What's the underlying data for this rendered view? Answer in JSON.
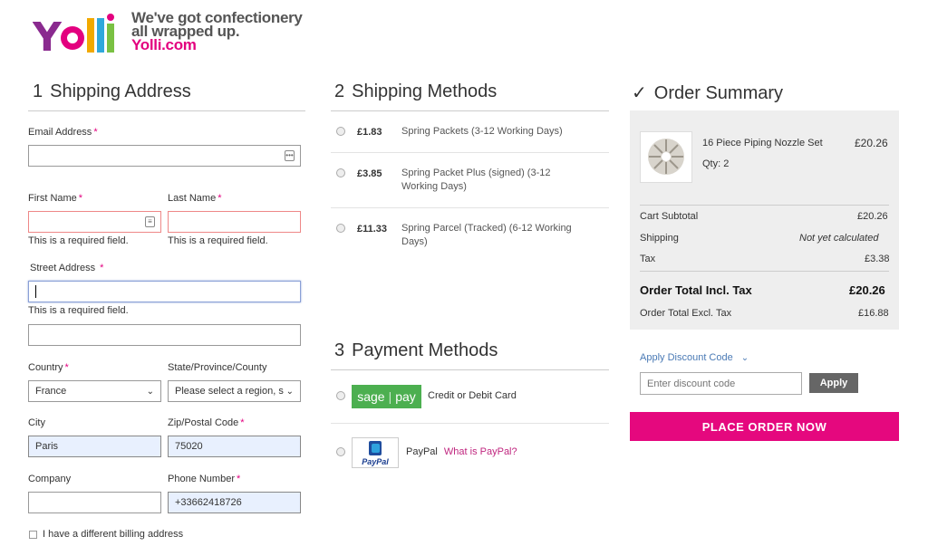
{
  "brand": {
    "logo_text": "Yolli",
    "tagline_line1": "We've got confectionery",
    "tagline_line2": "all wrapped up.",
    "tagline_url": "Yolli.com",
    "accent_color": "#e3007f"
  },
  "shipping_address": {
    "step": "1",
    "title": "Shipping Address",
    "required_mark": "*",
    "email_label": "Email Address",
    "email_value": "",
    "first_name_label": "First Name",
    "first_name_error": "This is a required field.",
    "last_name_label": "Last Name",
    "last_name_error": "This is a required field.",
    "street_label": "Street Address",
    "street_error": "This is a required field.",
    "country_label": "Country",
    "country_value": "France",
    "state_label": "State/Province/County",
    "state_value": "Please select a region, s",
    "city_label": "City",
    "city_value": "Paris",
    "zip_label": "Zip/Postal Code",
    "zip_value": "75020",
    "company_label": "Company",
    "company_value": "",
    "phone_label": "Phone Number",
    "phone_value": "+33662418726",
    "billing_checkbox_label": "I have a different billing address"
  },
  "shipping_methods": {
    "step": "2",
    "title": "Shipping Methods",
    "options": [
      {
        "price": "£1.83",
        "name": "Spring Packets (3-12 Working Days)"
      },
      {
        "price": "£3.85",
        "name": "Spring Packet Plus (signed) (3-12 Working Days)"
      },
      {
        "price": "£11.33",
        "name": "Spring Parcel (Tracked) (6-12 Working Days)"
      }
    ]
  },
  "payment_methods": {
    "step": "3",
    "title": "Payment Methods",
    "sage_logo_left": "sage",
    "sage_logo_right": "pay",
    "card_label": "Credit or Debit Card",
    "paypal_logo_text": "PayPal",
    "paypal_label": "PayPal",
    "paypal_link": "What is PayPal?"
  },
  "order_summary": {
    "check": "✓",
    "title": "Order Summary",
    "item_name": "16 Piece Piping Nozzle Set",
    "item_price": "£20.26",
    "item_qty": "Qty: 2",
    "cart_subtotal_label": "Cart Subtotal",
    "cart_subtotal_value": "£20.26",
    "shipping_label": "Shipping",
    "shipping_value": "Not yet calculated",
    "tax_label": "Tax",
    "tax_value": "£3.38",
    "total_incl_label": "Order Total Incl. Tax",
    "total_incl_value": "£20.26",
    "total_excl_label": "Order Total Excl. Tax",
    "total_excl_value": "£16.88",
    "discount_link": "Apply Discount Code",
    "discount_placeholder": "Enter discount code",
    "apply_label": "Apply",
    "place_order_label": "PLACE ORDER NOW"
  }
}
